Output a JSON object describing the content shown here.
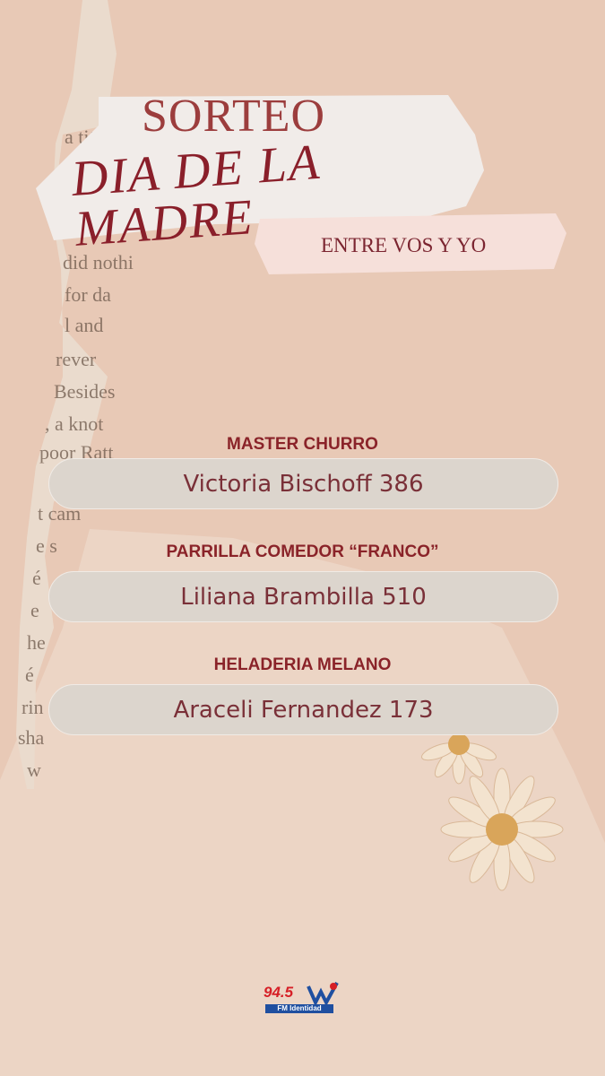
{
  "header": {
    "title": "SORTEO",
    "event": "DIA DE LA MADRE",
    "subtitle": "ENTRE VOS Y YO"
  },
  "prizes": [
    {
      "sponsor": "MASTER CHURRO",
      "winner": "Victoria Bischoff 386"
    },
    {
      "sponsor": "PARRILLA COMEDOR “FRANCO”",
      "winner": "Liliana Brambilla 510"
    },
    {
      "sponsor": "HELADERIA MELANO",
      "winner": "Araceli Fernandez 173"
    }
  ],
  "logo": {
    "frequency": "94.5",
    "tagline": "FM Identidad"
  },
  "colors": {
    "background": "#e8c9b6",
    "accent": "#8a2329",
    "pill": "#dcd5cd"
  }
}
